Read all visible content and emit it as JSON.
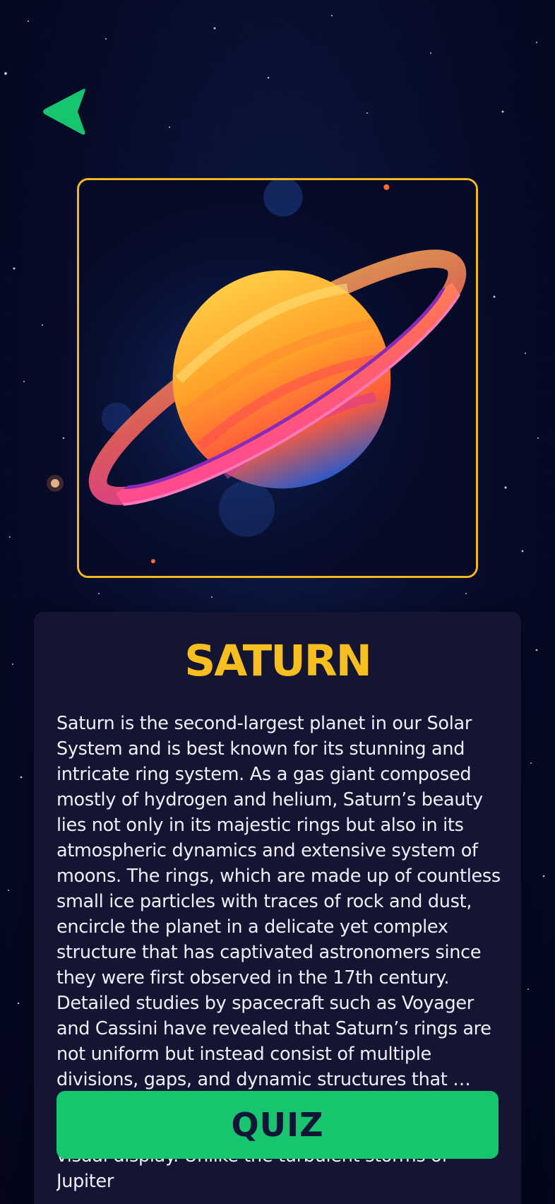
{
  "planet": {
    "name": "SATURN",
    "description": "Saturn is the second-largest planet in our Solar System and is best known for its stunning and intricate ring system. As a gas giant composed mostly of hydrogen and helium, Saturn’s beauty lies not only in its majestic rings but also in its atmospheric dynamics and extensive system of moons. The rings, which are made up of countless small ice particles with traces of rock and dust, encircle the planet in a delicate yet complex structure that has captivated astronomers since they were first observed in the 17th century. Detailed studies by spacecraft such as Voyager and Cassini have revealed that Saturn’s rings are not uniform but instead consist of multiple divisions, gaps, and dynamic structures that … Saturn’s atmosphere, marked by bands of clouds and powerful storms, creates a mesmerizing visual display. Unlike the turbulent storms of Jupiter"
  },
  "actions": {
    "quiz_label": "QUIZ"
  },
  "icons": {
    "back": "back-arrow-icon"
  },
  "colors": {
    "accent_yellow": "#f6bf1f",
    "button_green": "#17c56f",
    "card_bg": "#141532",
    "background": "#060b28"
  }
}
